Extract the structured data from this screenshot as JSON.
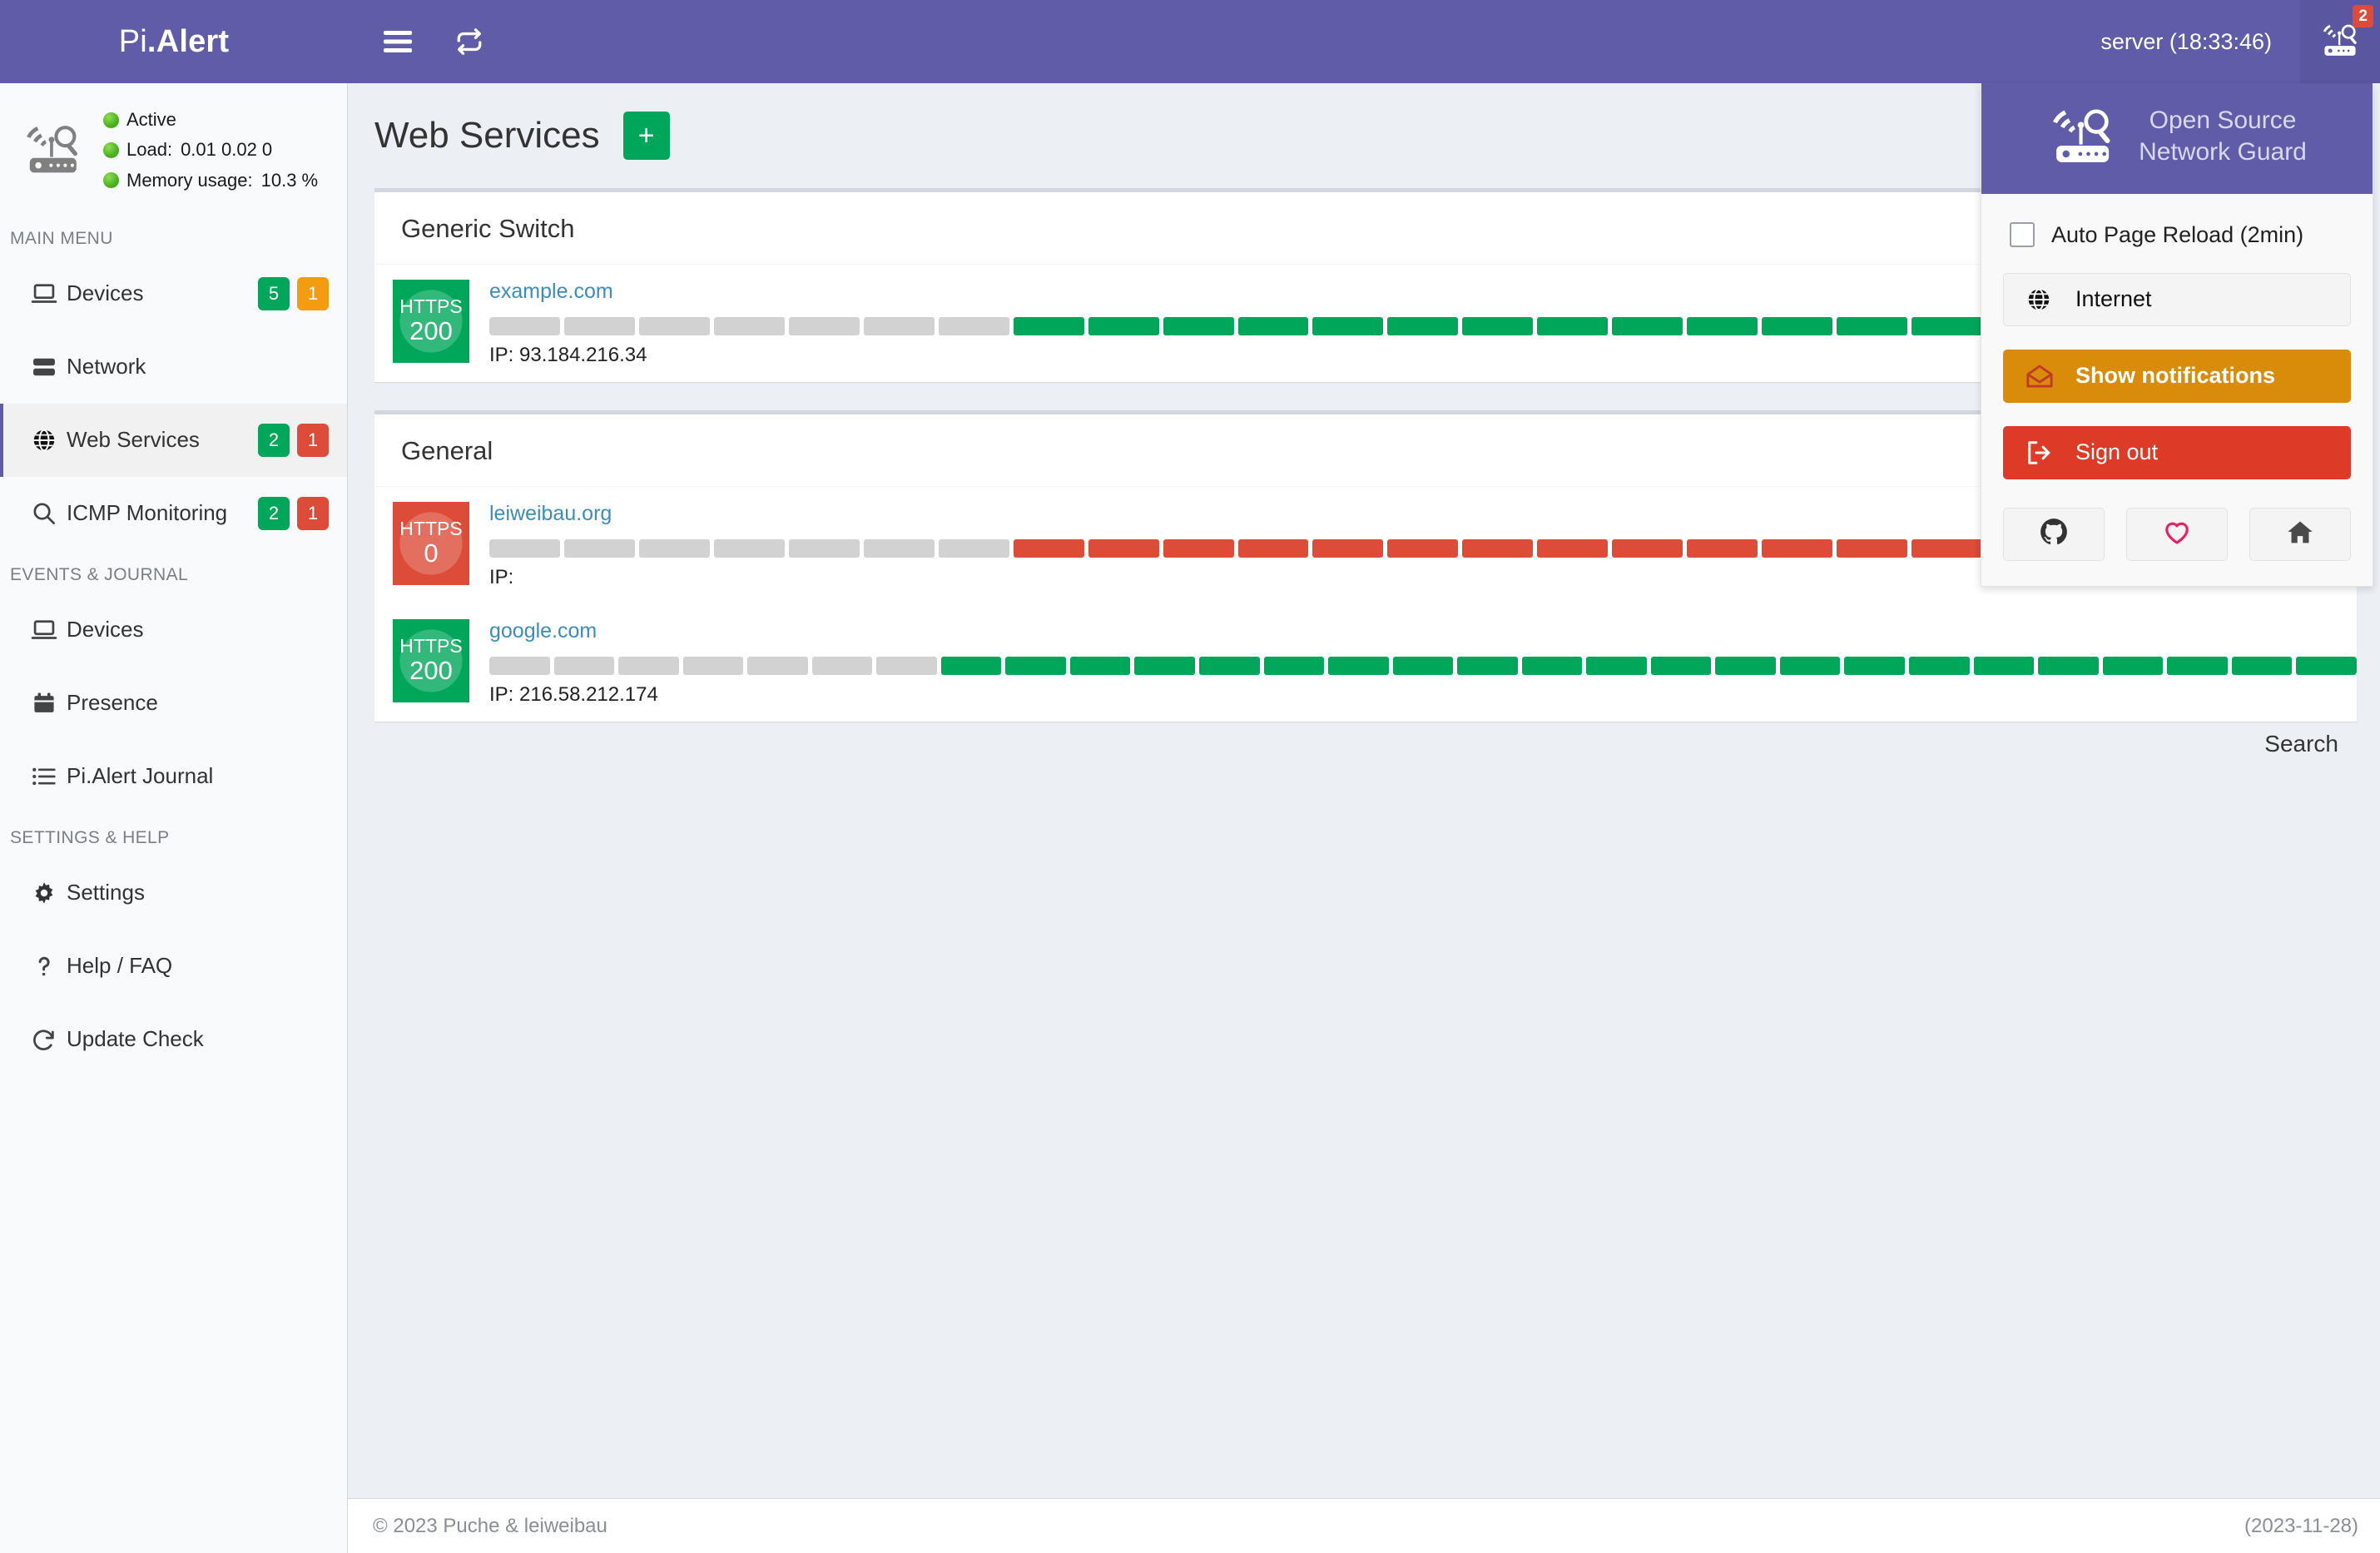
{
  "header": {
    "brand_prefix": "Pi",
    "brand_dot": ".",
    "brand_suffix": "Alert",
    "menu_toggle": "menu-toggle",
    "refresh": "refresh",
    "server_label": "server (18:33:46)",
    "user_badge": "2"
  },
  "sidebar": {
    "status": {
      "active": "Active",
      "load_label": "Load:",
      "load_value": "0.01  0.02  0",
      "memory_label": "Memory usage:",
      "memory_value": "10.3 %"
    },
    "sections": [
      {
        "title": "MAIN MENU",
        "items": [
          {
            "label": "Devices",
            "icon": "laptop-icon",
            "active": false,
            "badges": [
              {
                "text": "5",
                "color": "green"
              },
              {
                "text": "1",
                "color": "yellow"
              }
            ]
          },
          {
            "label": "Network",
            "icon": "server-rack-icon",
            "active": false,
            "badges": []
          },
          {
            "label": "Web Services",
            "icon": "globe-icon",
            "active": true,
            "badges": [
              {
                "text": "2",
                "color": "green"
              },
              {
                "text": "1",
                "color": "red"
              }
            ]
          },
          {
            "label": "ICMP Monitoring",
            "icon": "search-icon",
            "active": false,
            "badges": [
              {
                "text": "2",
                "color": "green"
              },
              {
                "text": "1",
                "color": "red"
              }
            ]
          }
        ]
      },
      {
        "title": "EVENTS & JOURNAL",
        "items": [
          {
            "label": "Devices",
            "icon": "laptop-icon",
            "active": false,
            "badges": []
          },
          {
            "label": "Presence",
            "icon": "calendar-icon",
            "active": false,
            "badges": []
          },
          {
            "label": "Pi.Alert Journal",
            "icon": "list-icon",
            "active": false,
            "badges": []
          }
        ]
      },
      {
        "title": "SETTINGS & HELP",
        "items": [
          {
            "label": "Settings",
            "icon": "gear-icon",
            "active": false,
            "badges": []
          },
          {
            "label": "Help / FAQ",
            "icon": "question-icon",
            "active": false,
            "badges": []
          },
          {
            "label": "Update Check",
            "icon": "refresh-icon",
            "active": false,
            "badges": []
          }
        ]
      }
    ]
  },
  "main": {
    "page_title": "Web Services",
    "add_label": "+",
    "search_label": "Search",
    "cards": [
      {
        "title": "Generic Switch",
        "services": [
          {
            "protocol": "HTTPS",
            "status_code": "200",
            "state": "ok",
            "host": "example.com",
            "ip_label": "IP: 93.184.216.34",
            "history": [
              "gray",
              "gray",
              "gray",
              "gray",
              "gray",
              "gray",
              "gray",
              "green",
              "green",
              "green",
              "green",
              "green",
              "green",
              "green",
              "green",
              "green",
              "green",
              "green",
              "green",
              "green",
              "green",
              "green",
              "green",
              "green",
              "green"
            ]
          }
        ]
      },
      {
        "title": "General",
        "services": [
          {
            "protocol": "HTTPS",
            "status_code": "0",
            "state": "bad",
            "host": "leiweibau.org",
            "ip_label": "IP:",
            "history": [
              "gray",
              "gray",
              "gray",
              "gray",
              "gray",
              "gray",
              "gray",
              "red",
              "red",
              "red",
              "red",
              "red",
              "red",
              "red",
              "red",
              "red",
              "red",
              "red",
              "red",
              "red",
              "red",
              "red",
              "red",
              "red",
              "red"
            ]
          },
          {
            "protocol": "HTTPS",
            "status_code": "200",
            "state": "ok",
            "host": "google.com",
            "ip_label": "IP: 216.58.212.174",
            "history": [
              "gray",
              "gray",
              "gray",
              "gray",
              "gray",
              "gray",
              "gray",
              "green",
              "green",
              "green",
              "green",
              "green",
              "green",
              "green",
              "green",
              "green",
              "green",
              "green",
              "green",
              "green",
              "green",
              "green",
              "green",
              "green",
              "green",
              "green",
              "green",
              "green",
              "green"
            ]
          }
        ]
      }
    ]
  },
  "footer": {
    "copyright": "© 2023 Puche & leiweibau",
    "version_date": "(2023-11-28)"
  },
  "panel": {
    "title_line1": "Open Source",
    "title_line2": "Network Guard",
    "auto_reload_label": "Auto Page Reload (2min)",
    "auto_reload_checked": false,
    "internet_label": "Internet",
    "notifications_label": "Show notifications",
    "signout_label": "Sign out",
    "links": [
      {
        "name": "github-icon"
      },
      {
        "name": "heart-icon"
      },
      {
        "name": "home-icon"
      }
    ]
  },
  "colors": {
    "brand_purple": "#605ca8",
    "ok_green": "#00a65a",
    "bad_red": "#dd4b39",
    "warn_orange": "#d98b0a",
    "danger_red": "#dd3b27",
    "link_blue": "#3c8dbc",
    "idle_gray": "#d2d2d2",
    "page_bg": "#ecf0f5"
  }
}
